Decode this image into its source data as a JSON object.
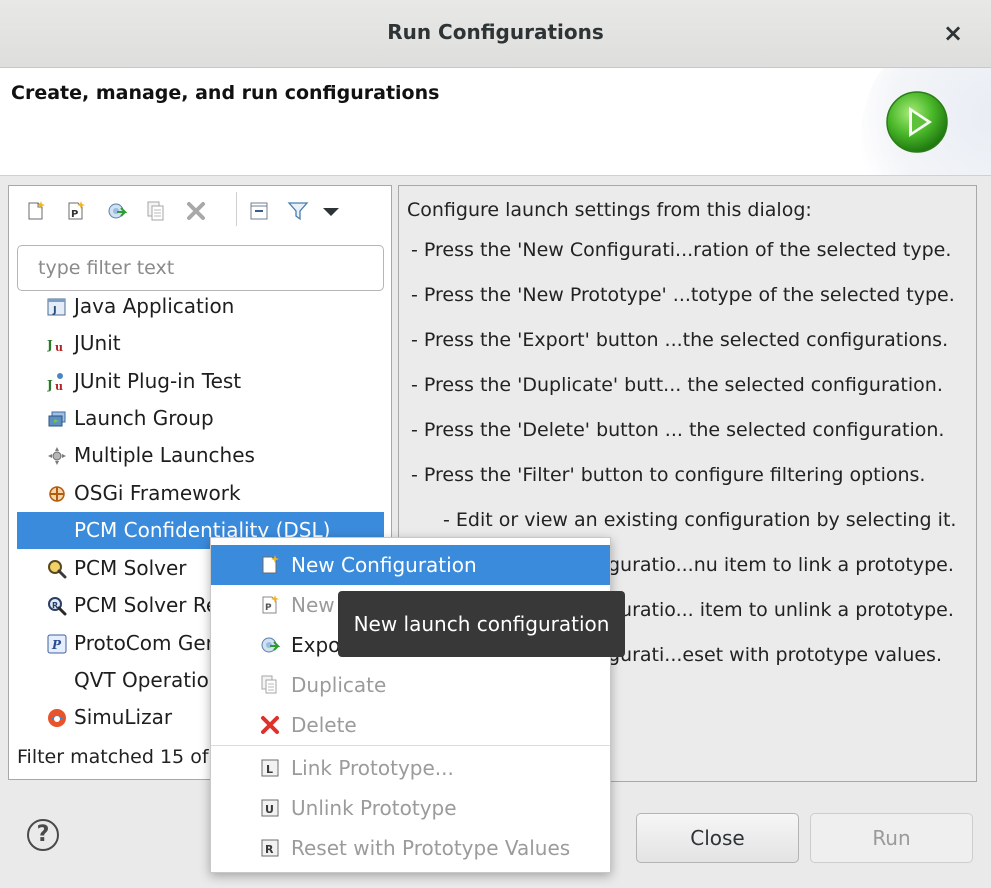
{
  "window": {
    "title": "Run Configurations",
    "close_glyph": "×"
  },
  "banner": {
    "heading": "Create, manage, and run configurations",
    "icon": "run-launch-icon"
  },
  "toolbar": {
    "buttons": [
      {
        "name": "new-configuration",
        "icon": "new-config-icon"
      },
      {
        "name": "new-prototype",
        "icon": "new-prototype-icon"
      },
      {
        "name": "export",
        "icon": "export-icon"
      },
      {
        "name": "duplicate",
        "icon": "duplicate-icon"
      },
      {
        "name": "delete",
        "icon": "delete-icon"
      },
      {
        "name": "collapse-all",
        "icon": "collapse-all-icon"
      },
      {
        "name": "filter",
        "icon": "filter-icon"
      },
      {
        "name": "view-menu",
        "icon": "dropdown-arrow-icon"
      }
    ]
  },
  "filter": {
    "placeholder": "type filter text",
    "value": ""
  },
  "tree": {
    "items": [
      {
        "label": "Java Application",
        "icon": "java-app-icon"
      },
      {
        "label": "JUnit",
        "icon": "junit-icon"
      },
      {
        "label": "JUnit Plug-in Test",
        "icon": "junit-plugin-icon"
      },
      {
        "label": "Launch Group",
        "icon": "launch-group-icon"
      },
      {
        "label": "Multiple Launches",
        "icon": "multiple-launches-icon"
      },
      {
        "label": "OSGi Framework",
        "icon": "osgi-icon"
      },
      {
        "label": "PCM Confidentiality (DSL)",
        "icon": "none",
        "selected": true
      },
      {
        "label": "PCM Solver",
        "icon": "pcm-solver-icon"
      },
      {
        "label": "PCM Solver Re",
        "icon": "pcm-solver-reliability-icon"
      },
      {
        "label": "ProtoCom Gen",
        "icon": "protocom-icon"
      },
      {
        "label": "QVT Operation",
        "icon": "none"
      },
      {
        "label": "SimuLizar",
        "icon": "simulizar-icon"
      }
    ]
  },
  "status": {
    "text": "Filter matched 15 of"
  },
  "info": {
    "lines": [
      "Configure launch settings from this dialog:",
      "- Press the 'New Configurati...ration of the selected type.",
      "- Press the 'New Prototype' ...totype of the selected type.",
      "- Press the 'Export' button ...the selected configurations.",
      "- Press the 'Duplicate' butt... the selected configuration.",
      "- Press the 'Delete' button ... the selected configuration.",
      "- Press the 'Filter' button to configure filtering options.",
      "- Edit or view an existing configuration by selecting it.",
      "guratio...nu item to link a prototype.",
      "guratio... item to unlink a prototype.",
      "gurati...eset with prototype values."
    ]
  },
  "context_menu": {
    "items": [
      {
        "label": "New Configuration",
        "icon": "new-config-icon",
        "state": "highlighted"
      },
      {
        "label": "New Prototype",
        "icon": "new-prototype-icon",
        "state": "disabled"
      },
      {
        "label": "Export...",
        "icon": "export-icon",
        "state": "enabled"
      },
      {
        "label": "Duplicate",
        "icon": "duplicate-icon",
        "state": "disabled"
      },
      {
        "label": "Delete",
        "icon": "delete-icon",
        "state": "disabled"
      },
      {
        "label": "Link Prototype...",
        "icon": "link-prototype-icon",
        "state": "disabled"
      },
      {
        "label": "Unlink Prototype",
        "icon": "unlink-prototype-icon",
        "state": "disabled"
      },
      {
        "label": "Reset with Prototype Values",
        "icon": "reset-prototype-icon",
        "state": "disabled"
      }
    ]
  },
  "tooltip": {
    "text": "New launch configuration"
  },
  "footer": {
    "help_glyph": "?",
    "close_label": "Close",
    "run_label": "Run",
    "run_enabled": false
  },
  "colors": {
    "selection": "#3a8bdc",
    "tooltip_bg": "#383838",
    "dialog_bg": "#eaeaea",
    "delete_red": "#e0302a",
    "run_green": "#3fae1f"
  }
}
